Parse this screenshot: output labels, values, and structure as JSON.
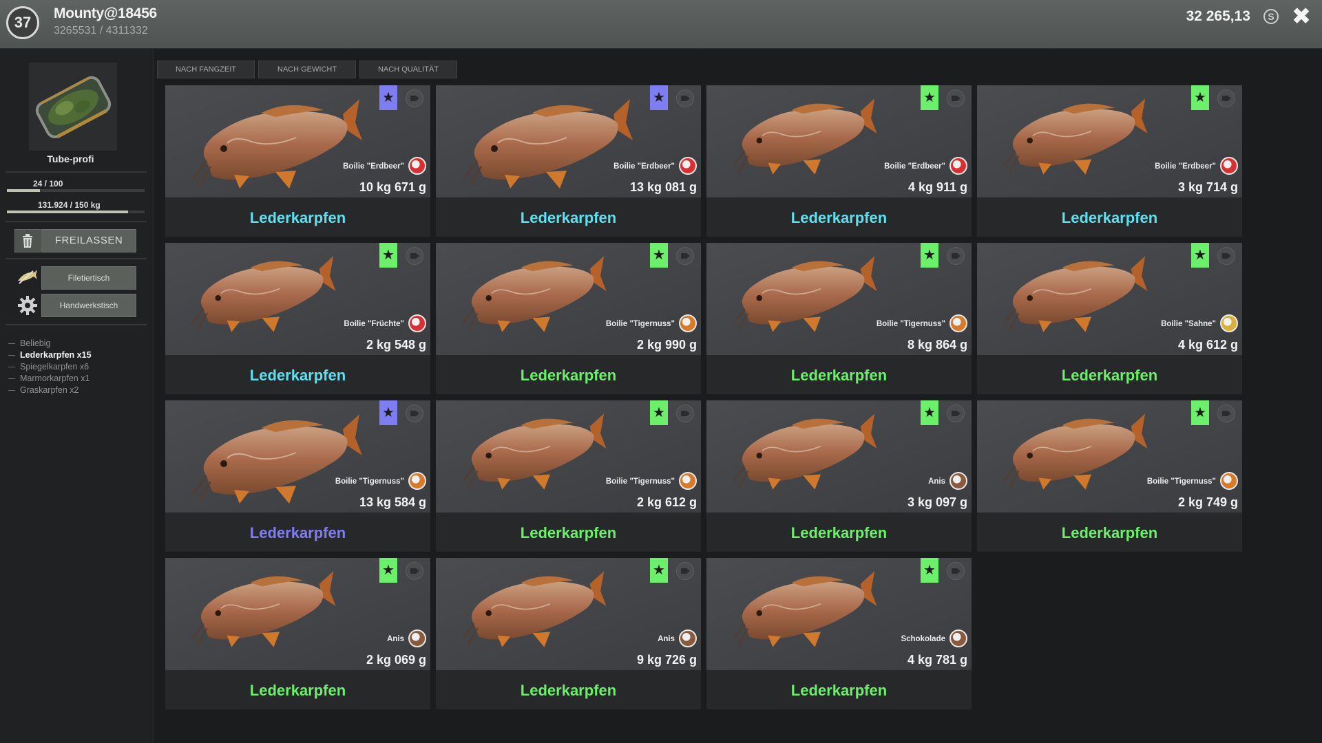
{
  "header": {
    "level": "37",
    "username": "Mounty@18456",
    "xp": "3265531 / 4311332",
    "money": "32 265,13",
    "currency_symbol": "S",
    "close_symbol": "✖"
  },
  "sidebar": {
    "bag_name": "Tube-profi",
    "slots_label": "24 / 100",
    "slots_fraction": 0.24,
    "weight_label": "131.924 / 150 kg",
    "weight_fraction": 0.8795,
    "release_label": "FREILASSEN",
    "fillet_label": "Filetiertisch",
    "craft_label": "Handwerkstisch",
    "filters": [
      {
        "label": "Beliebig",
        "active": false
      },
      {
        "label": "Lederkarpfen x15",
        "active": true
      },
      {
        "label": "Spiegelkarpfen x6",
        "active": false
      },
      {
        "label": "Marmorkarpfen x1",
        "active": false
      },
      {
        "label": "Graskarpfen x2",
        "active": false
      }
    ]
  },
  "tabs": [
    "NACH FANGZEIT",
    "NACH GEWICHT",
    "NACH QUALITÄT"
  ],
  "colors": {
    "cyan": "#5fe0f0",
    "green": "#6cf06c",
    "purple": "#7f7df2",
    "bait_red": "#d83030",
    "bait_orange": "#d77a2a",
    "bait_yellow": "#d9b13a",
    "bait_brown": "#8a5a3d"
  },
  "fish": [
    {
      "name": "Lederkarpfen",
      "name_color": "cyan",
      "badge_color": "purple",
      "bait": "Boilie \"Erdbeer\"",
      "bait_color": "bait_red",
      "weight": "10 kg 671 g",
      "scale": 1.0
    },
    {
      "name": "Lederkarpfen",
      "name_color": "cyan",
      "badge_color": "purple",
      "bait": "Boilie \"Erdbeer\"",
      "bait_color": "bait_red",
      "weight": "13 kg 081 g",
      "scale": 1.0
    },
    {
      "name": "Lederkarpfen",
      "name_color": "cyan",
      "badge_color": "green",
      "bait": "Boilie \"Erdbeer\"",
      "bait_color": "bait_red",
      "weight": "4 kg 911 g",
      "scale": 0.85
    },
    {
      "name": "Lederkarpfen",
      "name_color": "cyan",
      "badge_color": "green",
      "bait": "Boilie \"Erdbeer\"",
      "bait_color": "bait_red",
      "weight": "3 kg 714 g",
      "scale": 0.85
    },
    {
      "name": "Lederkarpfen",
      "name_color": "cyan",
      "badge_color": "green",
      "bait": "Boilie \"Früchte\"",
      "bait_color": "bait_red",
      "weight": "2 kg 548 g",
      "scale": 0.85
    },
    {
      "name": "Lederkarpfen",
      "name_color": "green",
      "badge_color": "green",
      "bait": "Boilie \"Tigernuss\"",
      "bait_color": "bait_orange",
      "weight": "2 kg 990 g",
      "scale": 0.85
    },
    {
      "name": "Lederkarpfen",
      "name_color": "green",
      "badge_color": "green",
      "bait": "Boilie \"Tigernuss\"",
      "bait_color": "bait_orange",
      "weight": "8 kg 864 g",
      "scale": 0.85
    },
    {
      "name": "Lederkarpfen",
      "name_color": "green",
      "badge_color": "green",
      "bait": "Boilie \"Sahne\"",
      "bait_color": "bait_yellow",
      "weight": "4 kg 612 g",
      "scale": 0.85
    },
    {
      "name": "Lederkarpfen",
      "name_color": "purple",
      "badge_color": "purple",
      "bait": "Boilie \"Tigernuss\"",
      "bait_color": "bait_orange",
      "weight": "13 kg 584 g",
      "scale": 1.0
    },
    {
      "name": "Lederkarpfen",
      "name_color": "green",
      "badge_color": "green",
      "bait": "Boilie \"Tigernuss\"",
      "bait_color": "bait_orange",
      "weight": "2 kg 612 g",
      "scale": 0.85
    },
    {
      "name": "Lederkarpfen",
      "name_color": "green",
      "badge_color": "green",
      "bait": "Anis",
      "bait_color": "bait_brown",
      "weight": "3 kg 097 g",
      "scale": 0.85
    },
    {
      "name": "Lederkarpfen",
      "name_color": "green",
      "badge_color": "green",
      "bait": "Boilie \"Tigernuss\"",
      "bait_color": "bait_orange",
      "weight": "2 kg 749 g",
      "scale": 0.85
    },
    {
      "name": "Lederkarpfen",
      "name_color": "green",
      "badge_color": "green",
      "bait": "Anis",
      "bait_color": "bait_brown",
      "weight": "2 kg 069 g",
      "scale": 0.85
    },
    {
      "name": "Lederkarpfen",
      "name_color": "green",
      "badge_color": "green",
      "bait": "Anis",
      "bait_color": "bait_brown",
      "weight": "9 kg 726 g",
      "scale": 0.85
    },
    {
      "name": "Lederkarpfen",
      "name_color": "green",
      "badge_color": "green",
      "bait": "Schokolade",
      "bait_color": "bait_brown",
      "weight": "4 kg 781 g",
      "scale": 0.85
    }
  ]
}
